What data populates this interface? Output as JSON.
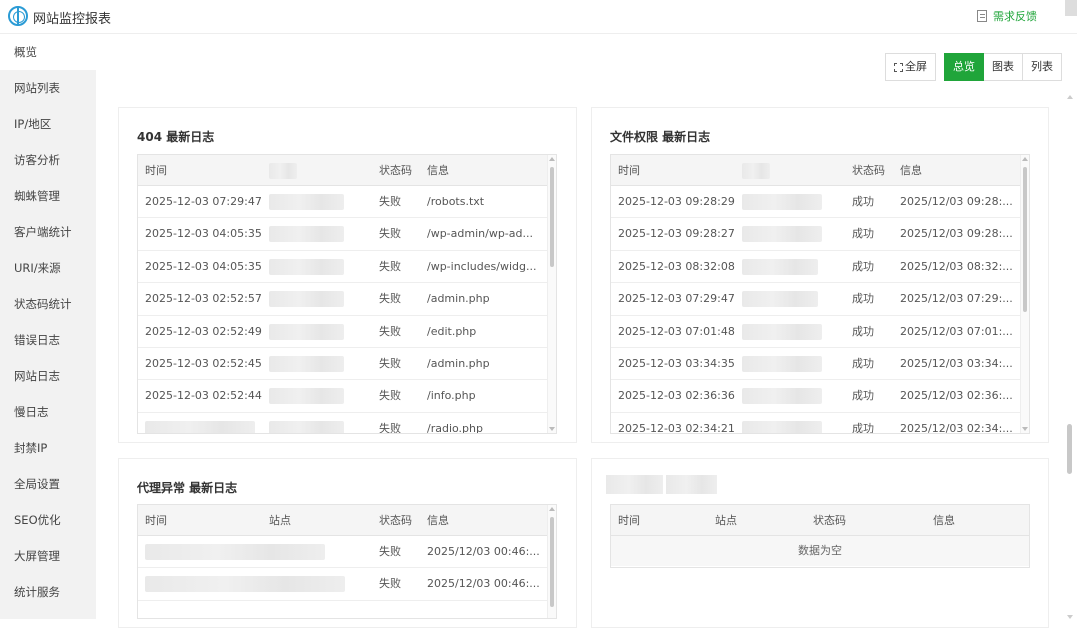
{
  "app": {
    "title": "网站监控报表",
    "feedback": "需求反馈"
  },
  "sidebar": {
    "items": [
      {
        "label": "概览"
      },
      {
        "label": "网站列表"
      },
      {
        "label": "IP/地区"
      },
      {
        "label": "访客分析"
      },
      {
        "label": "蜘蛛管理"
      },
      {
        "label": "客户端统计"
      },
      {
        "label": "URI/来源"
      },
      {
        "label": "状态码统计"
      },
      {
        "label": "错误日志"
      },
      {
        "label": "网站日志"
      },
      {
        "label": "慢日志"
      },
      {
        "label": "封禁IP"
      },
      {
        "label": "全局设置"
      },
      {
        "label": "SEO优化"
      },
      {
        "label": "大屏管理"
      },
      {
        "label": "统计服务"
      }
    ]
  },
  "toolbar": {
    "fullscreen": "全屏",
    "overview": "总览",
    "chart": "图表",
    "list": "列表"
  },
  "panel404": {
    "title": "404 最新日志",
    "headers": {
      "time": "时间",
      "status": "状态码",
      "info": "信息"
    },
    "rows": [
      {
        "time": "2025-12-03 07:29:47",
        "status": "失败",
        "info": "/robots.txt"
      },
      {
        "time": "2025-12-03 04:05:35",
        "status": "失败",
        "info": "/wp-admin/wp-ad..."
      },
      {
        "time": "2025-12-03 04:05:35",
        "status": "失败",
        "info": "/wp-includes/widg..."
      },
      {
        "time": "2025-12-03 02:52:57",
        "status": "失败",
        "info": "/admin.php"
      },
      {
        "time": "2025-12-03 02:52:49",
        "status": "失败",
        "info": "/edit.php"
      },
      {
        "time": "2025-12-03 02:52:45",
        "status": "失败",
        "info": "/admin.php"
      },
      {
        "time": "2025-12-03 02:52:44",
        "status": "失败",
        "info": "/info.php"
      },
      {
        "time": "",
        "status": "失败",
        "info": "/radio.php"
      }
    ]
  },
  "panelPerm": {
    "title": "文件权限 最新日志",
    "headers": {
      "time": "时间",
      "status": "状态码",
      "info": "信息"
    },
    "rows": [
      {
        "time": "2025-12-03 09:28:29",
        "status": "成功",
        "info": "2025/12/03 09:28:..."
      },
      {
        "time": "2025-12-03 09:28:27",
        "status": "成功",
        "info": "2025/12/03 09:28:..."
      },
      {
        "time": "2025-12-03 08:32:08",
        "status": "成功",
        "info": "2025/12/03 08:32:..."
      },
      {
        "time": "2025-12-03 07:29:47",
        "status": "成功",
        "info": "2025/12/03 07:29:..."
      },
      {
        "time": "2025-12-03 07:01:48",
        "status": "成功",
        "info": "2025/12/03 07:01:..."
      },
      {
        "time": "2025-12-03 03:34:35",
        "status": "成功",
        "info": "2025/12/03 03:34:..."
      },
      {
        "time": "2025-12-03 02:36:36",
        "status": "成功",
        "info": "2025/12/03 02:36:..."
      },
      {
        "time": "2025-12-03 02:34:21",
        "status": "成功",
        "info": "2025/12/03 02:34:..."
      }
    ]
  },
  "panelProxy": {
    "title": "代理异常 最新日志",
    "headers": {
      "time": "时间",
      "site": "站点",
      "status": "状态码",
      "info": "信息"
    },
    "rows": [
      {
        "status": "失败",
        "info": "2025/12/03 00:46:..."
      },
      {
        "status": "失败",
        "info": "2025/12/03 00:46:..."
      }
    ]
  },
  "panelEmpty": {
    "headers": {
      "time": "时间",
      "site": "站点",
      "status": "状态码",
      "info": "信息"
    },
    "empty": "数据为空"
  }
}
